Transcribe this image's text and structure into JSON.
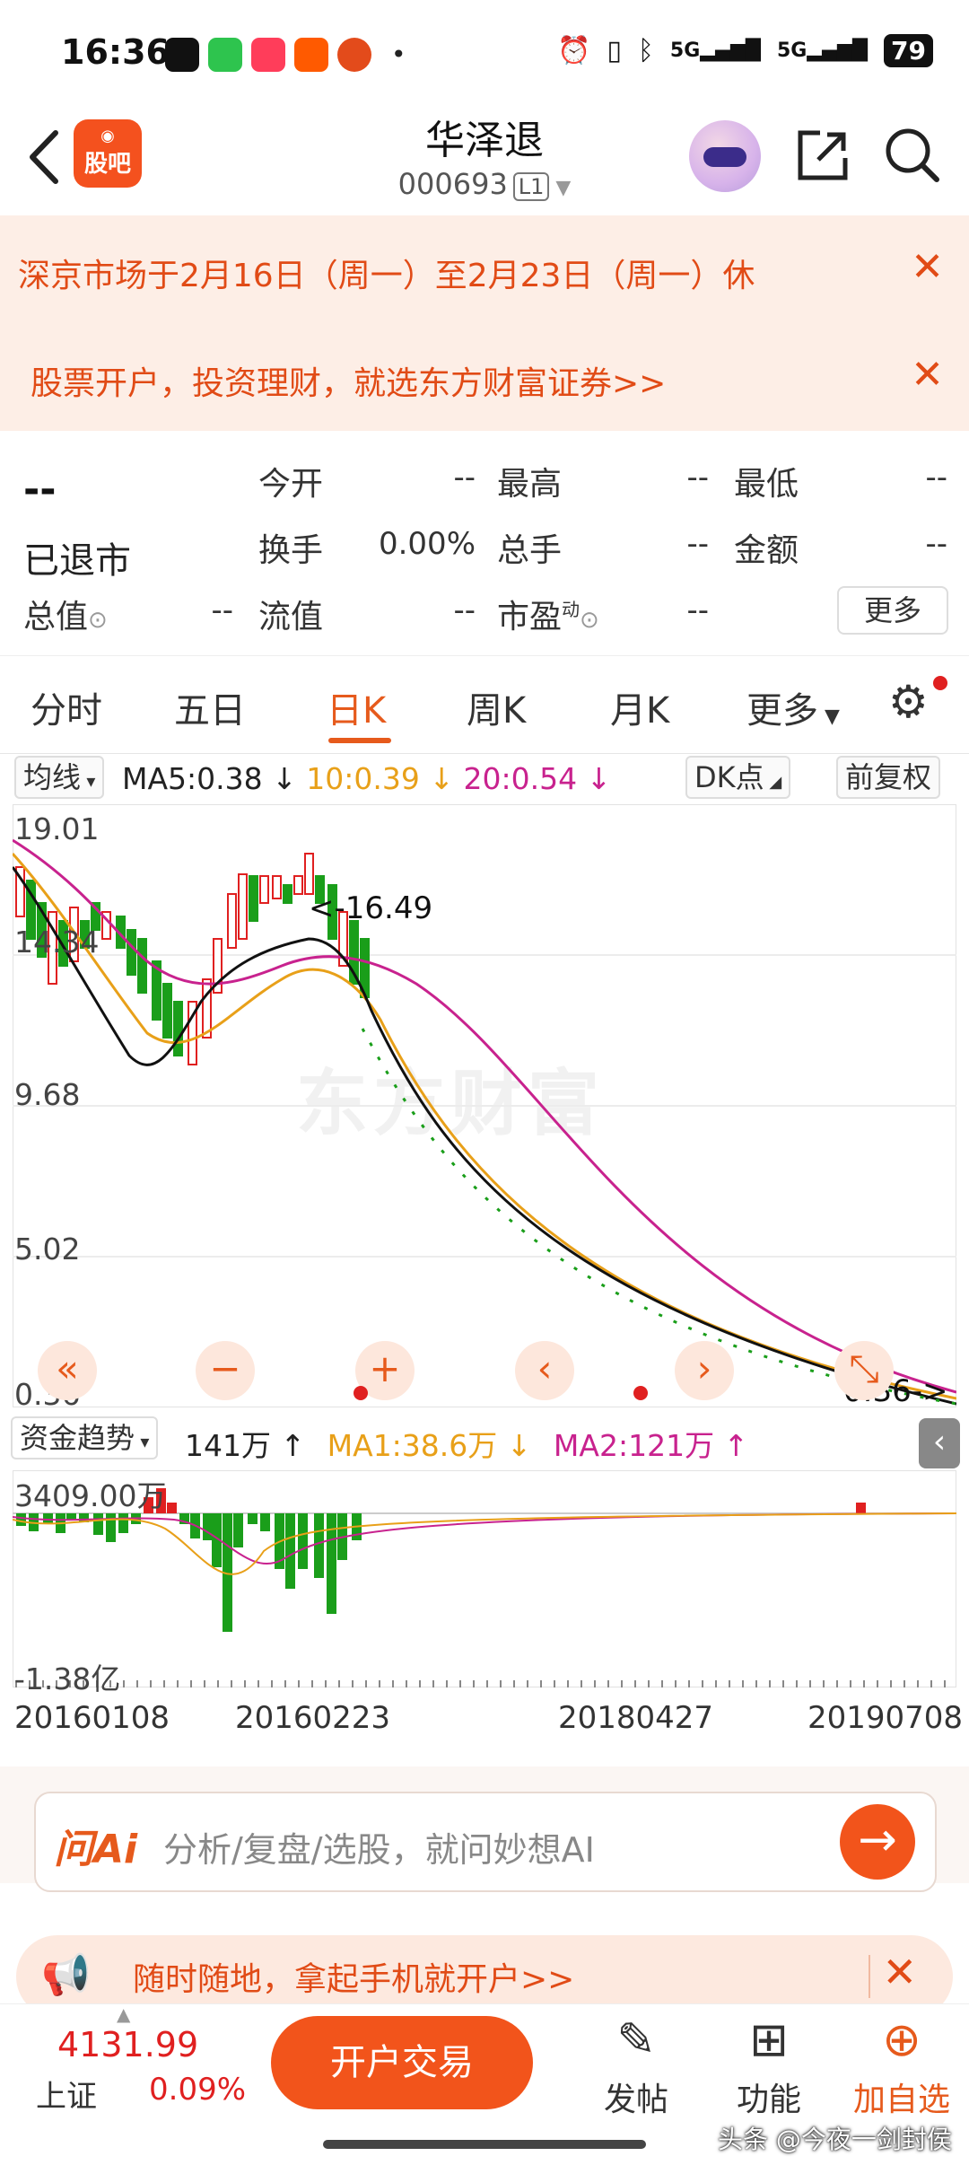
{
  "status_bar": {
    "time": "16:36",
    "network": "5G",
    "battery": "79"
  },
  "header": {
    "title": "华泽退",
    "code": "000693",
    "level": "L1",
    "forum_logo_text": "股吧"
  },
  "notices": [
    {
      "text": "深京市场于2月16日（周一）至2月23日（周一）休"
    },
    {
      "text": "股票开户，投资理财，就选东方财富证券>>"
    }
  ],
  "quote": {
    "price": "--",
    "status": "已退市",
    "fields": [
      {
        "label": "今开",
        "value": "--"
      },
      {
        "label": "最高",
        "value": "--"
      },
      {
        "label": "最低",
        "value": "--"
      },
      {
        "label": "换手",
        "value": "0.00%"
      },
      {
        "label": "总手",
        "value": "--"
      },
      {
        "label": "金额",
        "value": "--"
      },
      {
        "label": "总值",
        "value": "--"
      },
      {
        "label": "流值",
        "value": "--"
      },
      {
        "label": "市盈",
        "value": "--"
      }
    ],
    "pe_sup": "动",
    "more_label": "更多"
  },
  "tabs": [
    "分时",
    "五日",
    "日K",
    "周K",
    "月K",
    "更多"
  ],
  "active_tab": "日K",
  "indicator": {
    "selector": "均线",
    "ma5": "MA5:0.38 ↓",
    "ma10": "10:0.39 ↓",
    "ma20": "20:0.54 ↓",
    "dk": "DK点",
    "adjust": "前复权"
  },
  "chart": {
    "y_ticks": [
      "19.01",
      "14.34",
      "9.68",
      "5.02",
      "0.36"
    ],
    "annotation_high": "<-16.49",
    "annotation_low": "0.36->",
    "watermark": "东方财富"
  },
  "volume": {
    "selector": "资金趋势",
    "value": "141万 ↑",
    "ma1": "MA1:38.6万 ↓",
    "ma2": "MA2:121万 ↑",
    "y_top": "3409.00万",
    "y_bottom": "-1.38亿"
  },
  "x_dates": [
    "20160108",
    "20160223",
    "20180427",
    "20190708"
  ],
  "ai": {
    "logo": "问Ai",
    "placeholder": "分析/复盘/选股，就问妙想AI"
  },
  "promo": {
    "text": "随时随地，拿起手机就开户>>"
  },
  "bottom": {
    "index_value": "4131.99",
    "index_name": "上证",
    "index_change": "0.09%",
    "trade_label": "开户交易",
    "items": [
      "发帖",
      "功能",
      "加自选"
    ]
  },
  "credit": "头条 @今夜一剑封侯",
  "colors": {
    "accent": "#e65a1c",
    "up": "#e02020",
    "down": "#1a9e1a",
    "ma10": "#e8a019",
    "ma20": "#c8228e"
  },
  "chart_data": {
    "type": "candlestick",
    "y_range": [
      0.36,
      19.01
    ],
    "ma_values": {
      "MA5": 0.38,
      "MA10": 0.39,
      "MA20": 0.54
    },
    "high_marker": 16.49,
    "low_marker": 0.36,
    "x_ticks": [
      "20160108",
      "20160223",
      "20180427",
      "20190708"
    ]
  }
}
